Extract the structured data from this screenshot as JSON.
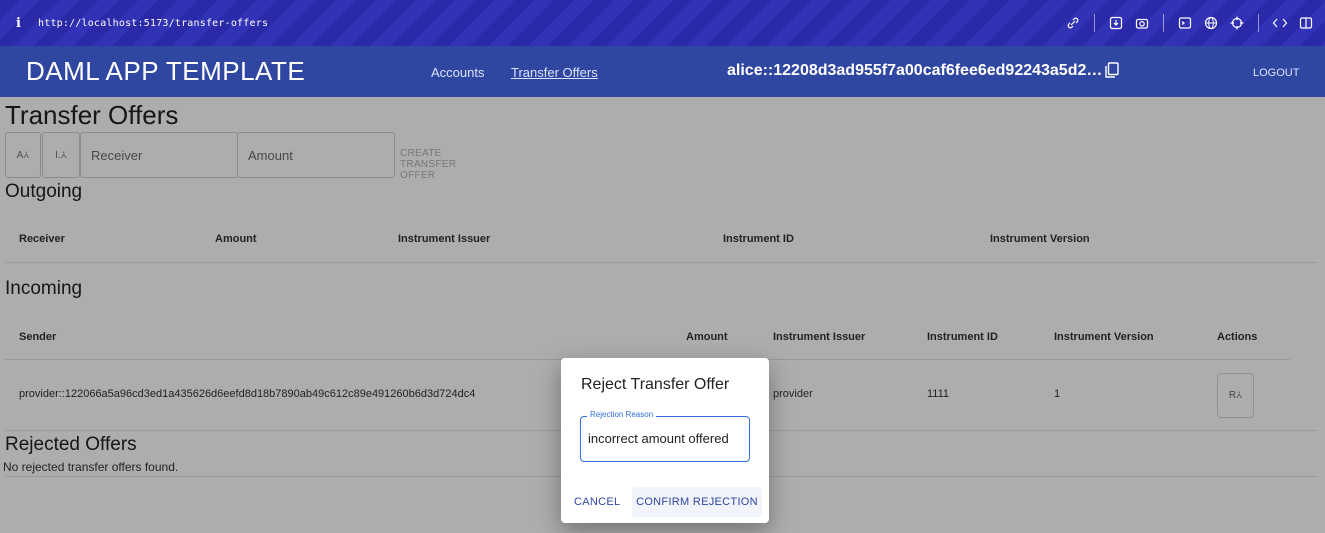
{
  "browser": {
    "info_glyph": "i",
    "url": "http://localhost:5173/transfer-offers",
    "toolbar_icons": [
      "link-icon",
      "save-icon",
      "camera-icon",
      "terminal-icon",
      "globe-icon",
      "crosshair-icon",
      "code-icon",
      "sidebar-icon"
    ]
  },
  "header": {
    "brand": "DAML APP TEMPLATE",
    "nav": {
      "accounts": "Accounts",
      "transfer_offers": "Transfer Offers"
    },
    "party": "alice::12208d3ad955f7a00caf6fee6ed92243a5d2…",
    "logout": "LOGOUT"
  },
  "page": {
    "title": "Transfer Offers",
    "toolbar": {
      "btn1": "A⩑",
      "btn2": "I.⩑",
      "receiver_placeholder": "Receiver",
      "amount_placeholder": "Amount",
      "create_label": "CREATE TRANSFER OFFER"
    }
  },
  "outgoing": {
    "title": "Outgoing",
    "columns": [
      "Receiver",
      "Amount",
      "Instrument Issuer",
      "Instrument ID",
      "Instrument Version"
    ]
  },
  "incoming": {
    "title": "Incoming",
    "columns": [
      "Sender",
      "Amount",
      "Instrument Issuer",
      "Instrument ID",
      "Instrument Version",
      "Actions"
    ],
    "row": {
      "sender": "provider::122066a5a96cd3ed1a435626d6eefd8d18b7890ab49c612c89e491260b6d3d724dc4",
      "issuer": "provider",
      "instrument_id": "1111",
      "version": "1",
      "action_label": "R⩑"
    }
  },
  "rejected": {
    "title": "Rejected Offers",
    "empty": "No rejected transfer offers found."
  },
  "dialog": {
    "title": "Reject Transfer Offer",
    "field_label": "Rejection Reason",
    "field_value": "incorrect amount offered",
    "cancel": "CANCEL",
    "confirm": "CONFIRM REJECTION"
  },
  "colors": {
    "browser_bar": "#2a2aa8",
    "app_bar": "#2f47a0",
    "accent": "#2f6fd8"
  }
}
